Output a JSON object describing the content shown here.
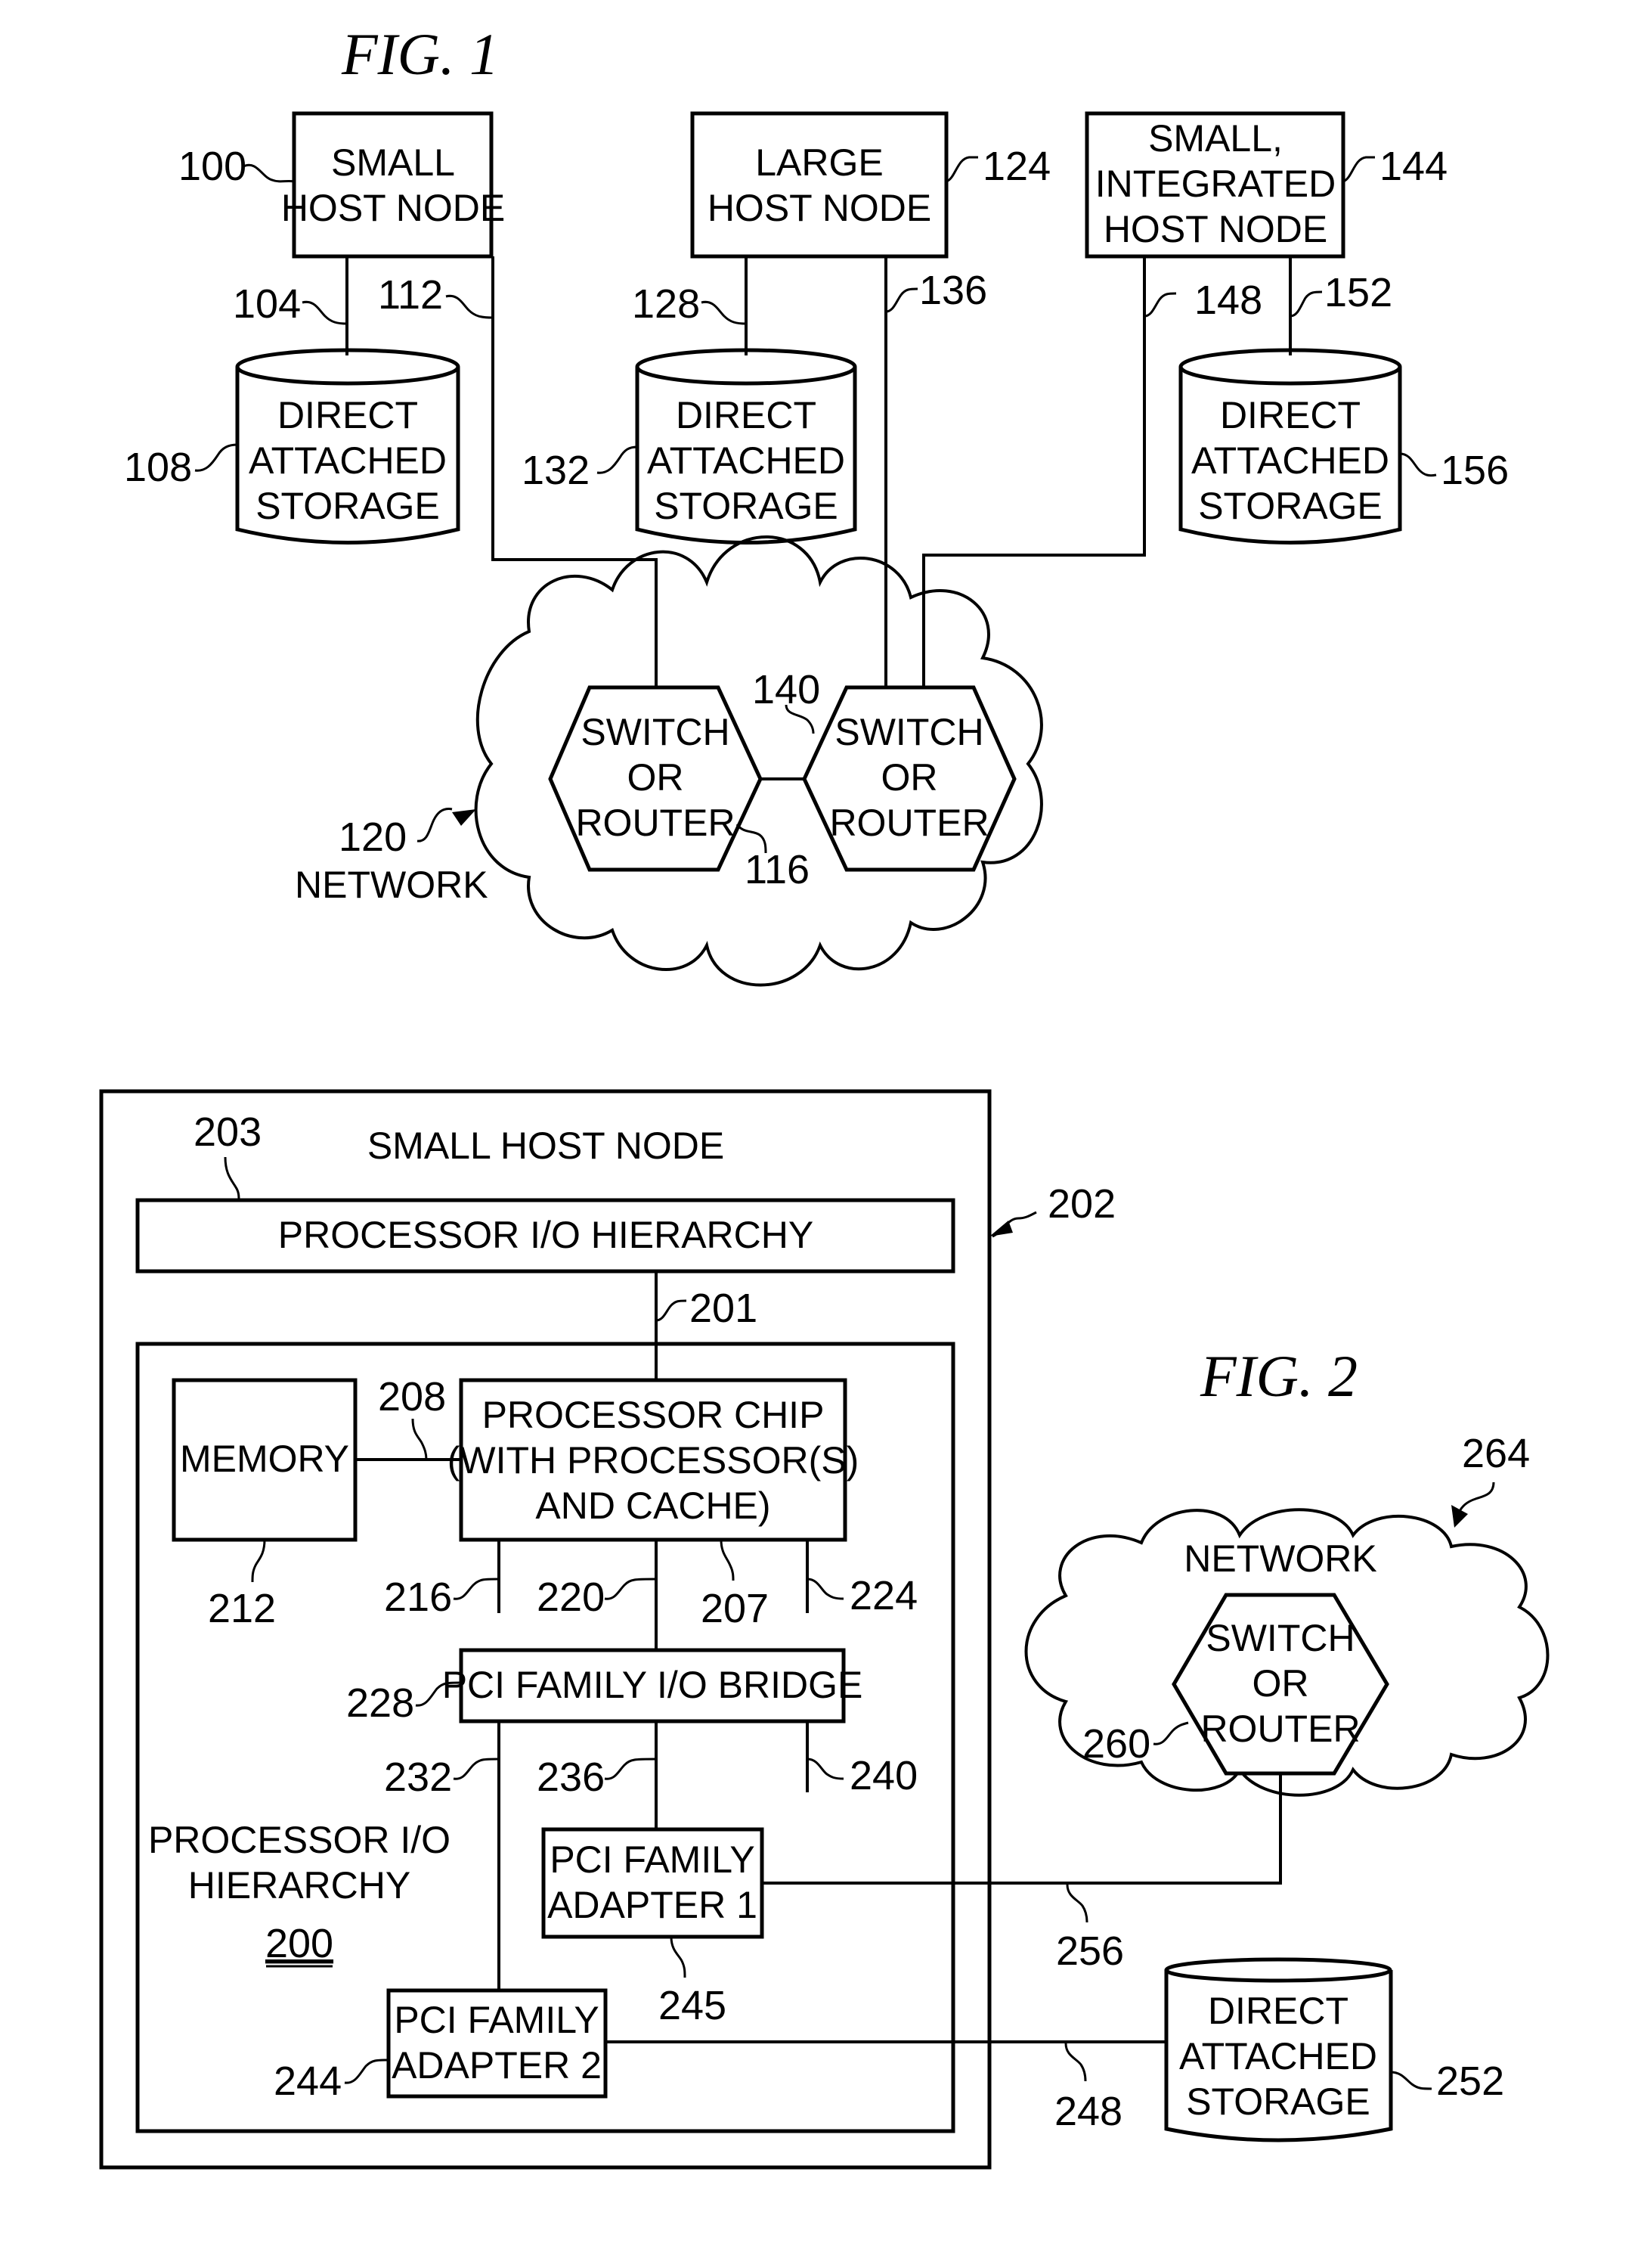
{
  "fig1": {
    "title": "FIG. 1",
    "small_host": {
      "lines": [
        "SMALL",
        "HOST NODE"
      ],
      "ref": "100"
    },
    "large_host": {
      "lines": [
        "LARGE",
        "HOST NODE"
      ],
      "ref": "124"
    },
    "integrated_host": {
      "lines": [
        "SMALL,",
        "INTEGRATED",
        "HOST NODE"
      ],
      "ref": "144"
    },
    "storage_108": {
      "lines": [
        "DIRECT",
        "ATTACHED",
        "STORAGE"
      ],
      "ref": "108"
    },
    "storage_132": {
      "lines": [
        "DIRECT",
        "ATTACHED",
        "STORAGE"
      ],
      "ref": "132"
    },
    "storage_156": {
      "lines": [
        "DIRECT",
        "ATTACHED",
        "STORAGE"
      ],
      "ref": "156"
    },
    "links": {
      "l104": "104",
      "l112": "112",
      "l128": "128",
      "l136": "136",
      "l148": "148",
      "l152": "152",
      "l140": "140"
    },
    "switch_116": {
      "lines": [
        "SWITCH",
        "OR",
        "ROUTER"
      ],
      "ref": "116"
    },
    "switch_b": {
      "lines": [
        "SWITCH",
        "OR",
        "ROUTER"
      ]
    },
    "network": {
      "ref": "120",
      "label": "NETWORK"
    }
  },
  "fig2": {
    "title": "FIG. 2",
    "host_label": "SMALL HOST NODE",
    "host_ref": "202",
    "proc_io_bar": {
      "label": "PROCESSOR I/O HIERARCHY",
      "ref": "203"
    },
    "link_201": "201",
    "memory": {
      "label": "MEMORY",
      "ref": "212"
    },
    "link_208": "208",
    "processor_chip": {
      "lines": [
        "PROCESSOR CHIP",
        "(WITH PROCESSOR(S)",
        "AND CACHE)"
      ],
      "ref": "207"
    },
    "links": {
      "l216": "216",
      "l220": "220",
      "l224": "224",
      "l232": "232",
      "l236": "236",
      "l240": "240",
      "l256": "256",
      "l248": "248"
    },
    "bridge": {
      "label": "PCI FAMILY I/O BRIDGE",
      "ref": "228"
    },
    "hierarchy_label": {
      "lines": [
        "PROCESSOR I/O",
        "HIERARCHY"
      ],
      "ref": "200"
    },
    "adapter1": {
      "lines": [
        "PCI FAMILY",
        "ADAPTER 1"
      ],
      "ref": "245"
    },
    "adapter2": {
      "lines": [
        "PCI FAMILY",
        "ADAPTER 2"
      ],
      "ref": "244"
    },
    "network": {
      "label": "NETWORK",
      "ref": "264"
    },
    "switch_260": {
      "lines": [
        "SWITCH",
        "OR",
        "ROUTER"
      ],
      "ref": "260"
    },
    "storage_252": {
      "lines": [
        "DIRECT",
        "ATTACHED",
        "STORAGE"
      ],
      "ref": "252"
    }
  }
}
